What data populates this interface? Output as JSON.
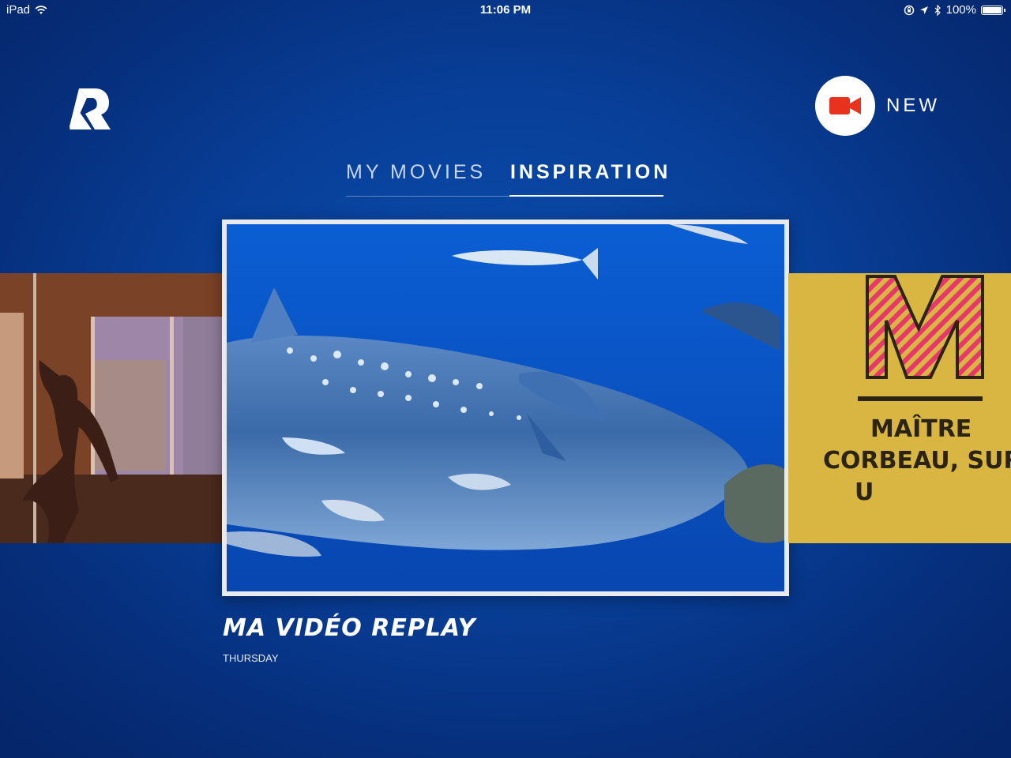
{
  "status_bar": {
    "device": "iPad",
    "time": "11:06 PM",
    "battery": "100%",
    "battery_level": 1.0
  },
  "header": {
    "new_label": "NEW",
    "accent_color": "#e8321e"
  },
  "tabs": [
    {
      "label": "MY MOVIES",
      "active": false
    },
    {
      "label": "INSPIRATION",
      "active": true
    }
  ],
  "carousel": {
    "right_card_title_lines": [
      "MAÎTRE",
      "CORBEAU, SUR",
      "U"
    ],
    "right_card_letter": "M"
  },
  "selected": {
    "title": "MA VIDÉO REPLAY",
    "date": "THURSDAY"
  }
}
